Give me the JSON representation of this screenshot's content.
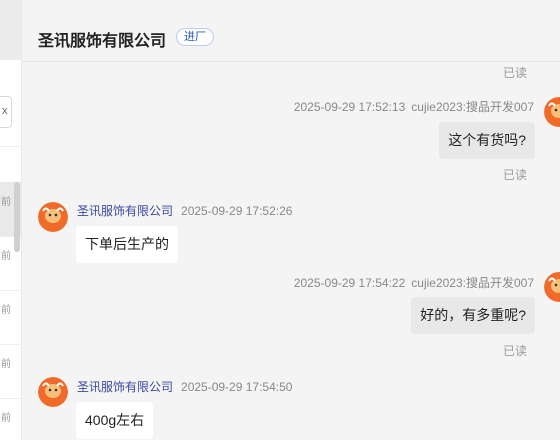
{
  "sidebar": {
    "search_glyph": "x",
    "item_times": [
      "前",
      "前",
      "前",
      "前",
      "前"
    ]
  },
  "header": {
    "title": "圣讯服饰有限公司",
    "badge": "进厂"
  },
  "messages": [
    {
      "side": "right",
      "read": "已读"
    },
    {
      "side": "right",
      "time": "2025-09-29 17:52:13",
      "sender": "cujie2023:搜品开发007",
      "text": "这个有货吗?",
      "read": "已读"
    },
    {
      "side": "left",
      "sender": "圣讯服饰有限公司",
      "time": "2025-09-29 17:52:26",
      "text": "下单后生产的"
    },
    {
      "side": "right",
      "time": "2025-09-29 17:54:22",
      "sender": "cujie2023:搜品开发007",
      "text": "好的，有多重呢?",
      "read": "已读"
    },
    {
      "side": "left",
      "sender": "圣讯服饰有限公司",
      "time": "2025-09-29 17:54:50",
      "text": "400g左右"
    }
  ],
  "colors": {
    "avatar_bg": "#f06a2a",
    "badge_text": "#2456b8",
    "sender_name": "#3a4aa0"
  },
  "icons": {
    "avatar": "ox-avatar-icon"
  }
}
